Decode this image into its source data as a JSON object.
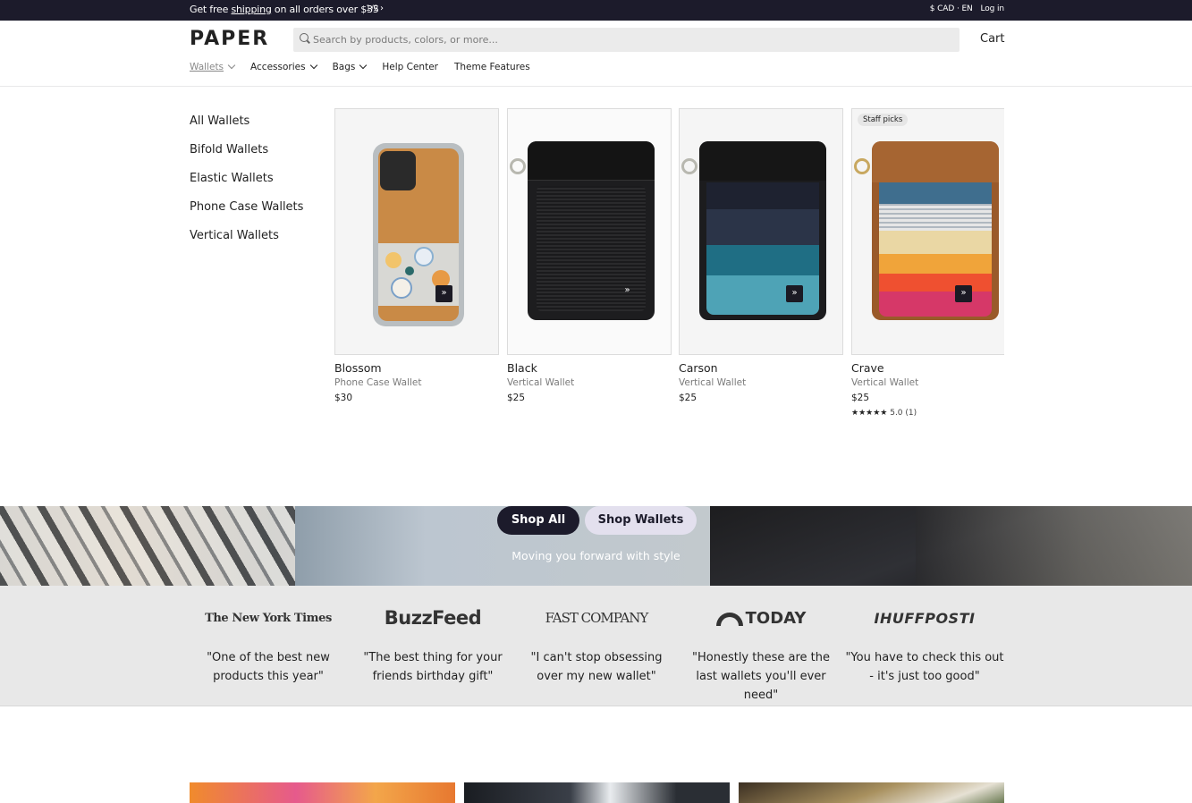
{
  "announcement": {
    "text_before": "Get free ",
    "link": "shipping",
    "text_after": " on all orders over $35",
    "pager": "1/2",
    "currency": "$ CAD · EN",
    "login": "Log in"
  },
  "header": {
    "logo": "PAPER",
    "search_placeholder": "Search by products, colors, or more...",
    "cart": "Cart"
  },
  "nav": [
    {
      "label": "Wallets",
      "has_dropdown": true,
      "active": true
    },
    {
      "label": "Accessories",
      "has_dropdown": true
    },
    {
      "label": "Bags",
      "has_dropdown": true
    },
    {
      "label": "Help Center",
      "has_dropdown": false
    },
    {
      "label": "Theme Features",
      "has_dropdown": false
    }
  ],
  "submenu": [
    "All Wallets",
    "Bifold Wallets",
    "Elastic Wallets",
    "Phone Case Wallets",
    "Vertical Wallets"
  ],
  "products": [
    {
      "name": "Blossom",
      "type": "Phone Case Wallet",
      "price": "$30"
    },
    {
      "name": "Black",
      "type": "Vertical Wallet",
      "price": "$25"
    },
    {
      "name": "Carson",
      "type": "Vertical Wallet",
      "price": "$25"
    },
    {
      "name": "Crave",
      "type": "Vertical Wallet",
      "price": "$25",
      "badge": "Staff picks",
      "stars": "★★★★★",
      "rating": "5.0",
      "reviews": "(1)"
    }
  ],
  "banner": {
    "shop_all": "Shop All",
    "shop_wallets": "Shop Wallets",
    "tagline": "Moving you forward with style"
  },
  "press": [
    {
      "logo": "The New York Times",
      "quote": "\"One of the best new products this year\""
    },
    {
      "logo": "BuzzFeed",
      "quote": "\"The best thing for your friends birthday gift\""
    },
    {
      "logo": "FAST COMPANY",
      "quote": "\"I can't stop obsessing over my new wallet\""
    },
    {
      "logo": "TODAY",
      "quote": "\"Honestly these are the last wallets you'll ever need\""
    },
    {
      "logo": "IHUFFPOSTI",
      "quote": "\"You have to check this out - it's just too good\""
    }
  ],
  "colors": {
    "announcement_bg": "#1c1b2b",
    "primary_button": "#1c1b2b",
    "secondary_button": "#e3e0ee",
    "press_bg": "#e8e8e8"
  }
}
